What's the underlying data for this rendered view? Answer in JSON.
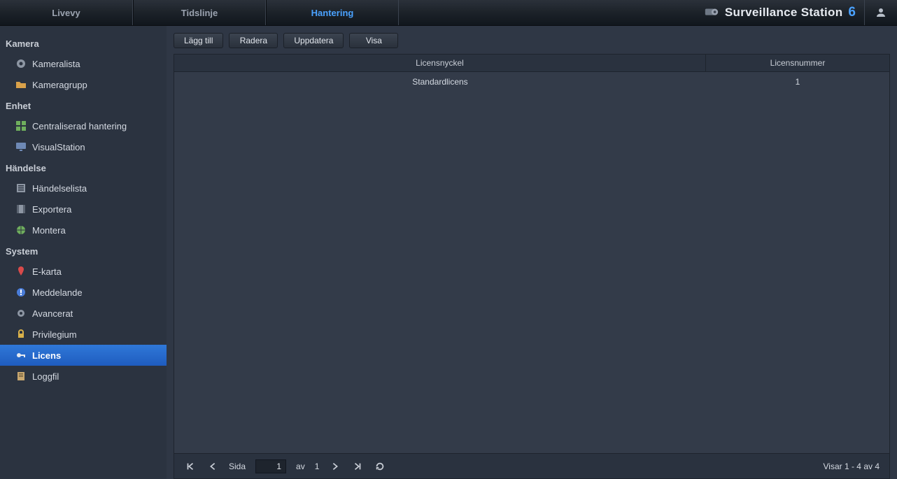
{
  "topbar": {
    "tabs": [
      {
        "label": "Livevy",
        "active": false
      },
      {
        "label": "Tidslinje",
        "active": false
      },
      {
        "label": "Hantering",
        "active": true
      }
    ],
    "brand_title": "Surveillance Station",
    "brand_version": "6"
  },
  "sidebar": {
    "groups": [
      {
        "title": "Kamera",
        "items": [
          {
            "label": "Kameralista",
            "icon": "camera-icon",
            "active": false
          },
          {
            "label": "Kameragrupp",
            "icon": "folder-icon",
            "active": false
          }
        ]
      },
      {
        "title": "Enhet",
        "items": [
          {
            "label": "Centraliserad hantering",
            "icon": "grid-icon",
            "active": false
          },
          {
            "label": "VisualStation",
            "icon": "monitor-icon",
            "active": false
          }
        ]
      },
      {
        "title": "Händelse",
        "items": [
          {
            "label": "Händelselista",
            "icon": "list-icon",
            "active": false
          },
          {
            "label": "Exportera",
            "icon": "film-icon",
            "active": false
          },
          {
            "label": "Montera",
            "icon": "globe-icon",
            "active": false
          }
        ]
      },
      {
        "title": "System",
        "items": [
          {
            "label": "E-karta",
            "icon": "pin-icon",
            "active": false
          },
          {
            "label": "Meddelande",
            "icon": "alert-icon",
            "active": false
          },
          {
            "label": "Avancerat",
            "icon": "gear-icon",
            "active": false
          },
          {
            "label": "Privilegium",
            "icon": "lock-icon",
            "active": false
          },
          {
            "label": "Licens",
            "icon": "key-icon",
            "active": true
          },
          {
            "label": "Loggfil",
            "icon": "log-icon",
            "active": false
          }
        ]
      }
    ]
  },
  "toolbar": {
    "add_label": "Lägg till",
    "delete_label": "Radera",
    "update_label": "Uppdatera",
    "view_label": "Visa"
  },
  "grid": {
    "columns": {
      "key": "Licensnyckel",
      "number": "Licensnummer"
    },
    "rows": [
      {
        "key": "Standardlicens",
        "number": "1"
      }
    ]
  },
  "pager": {
    "page_label": "Sida",
    "page_value": "1",
    "of_label": "av",
    "total_pages": "1",
    "status": "Visar 1 - 4 av 4"
  }
}
